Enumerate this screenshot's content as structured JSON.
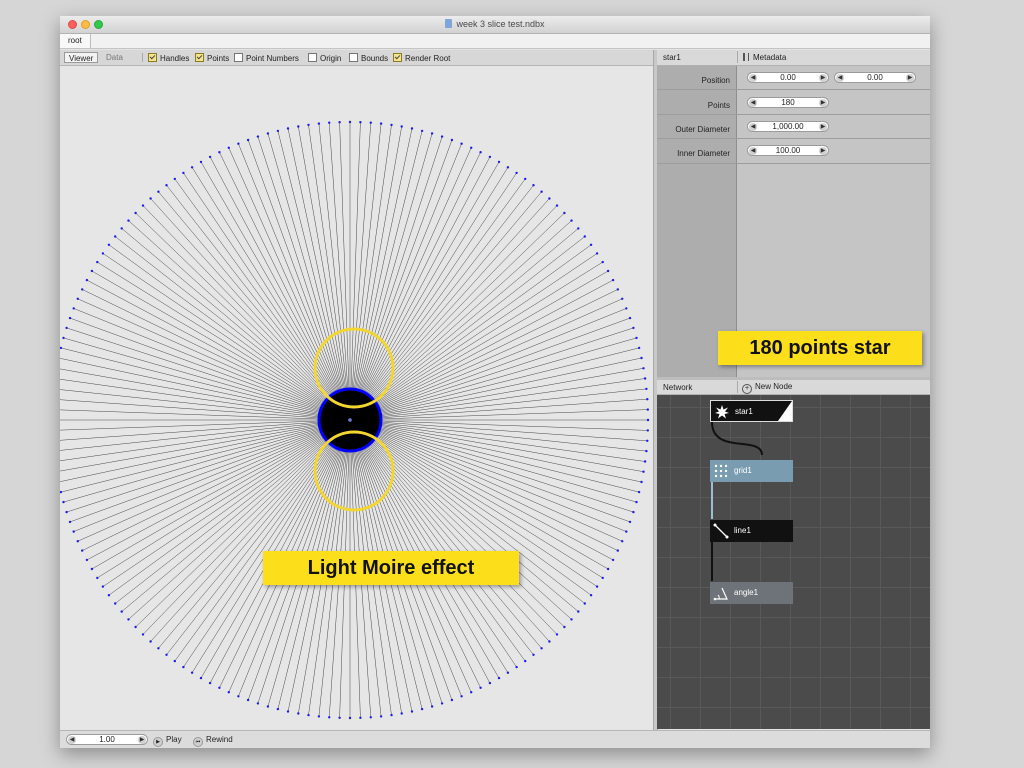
{
  "window": {
    "title": "week 3 slice test.ndbx"
  },
  "path": {
    "crumb": "root"
  },
  "viewer": {
    "tabs": [
      "Viewer",
      "Data"
    ],
    "toggles": [
      {
        "label": "Handles",
        "checked": true
      },
      {
        "label": "Points",
        "checked": true
      },
      {
        "label": "Point Numbers",
        "checked": false
      },
      {
        "label": "Origin",
        "checked": false
      },
      {
        "label": "Bounds",
        "checked": false
      },
      {
        "label": "Render Root",
        "checked": true
      }
    ],
    "star_points": 180,
    "callout": "Light Moire effect"
  },
  "parameters": {
    "node_name": "star1",
    "metadata_label": "Metadata",
    "rows": [
      {
        "label": "Position",
        "values": [
          "0.00",
          "0.00"
        ]
      },
      {
        "label": "Points",
        "values": [
          "180"
        ]
      },
      {
        "label": "Outer Diameter",
        "values": [
          "1,000.00"
        ]
      },
      {
        "label": "Inner Diameter",
        "values": [
          "100.00"
        ]
      }
    ],
    "callout": "180 points star"
  },
  "network": {
    "title": "Network",
    "new_node_label": "New Node",
    "nodes": [
      {
        "name": "star1",
        "icon": "star-icon",
        "color": "#111111"
      },
      {
        "name": "grid1",
        "icon": "grid-icon",
        "color": "#7a9cb0"
      },
      {
        "name": "line1",
        "icon": "line-icon",
        "color": "#111111"
      },
      {
        "name": "angle1",
        "icon": "angle-icon",
        "color": "#6d7378"
      }
    ]
  },
  "bottom": {
    "frame_value": "1.00",
    "play_label": "Play",
    "rewind_label": "Rewind"
  },
  "colors": {
    "callout": "#fdde1a",
    "highlight_ring": "#f4d630",
    "star_center": "#0000ff",
    "points": "#1c1ce6"
  }
}
